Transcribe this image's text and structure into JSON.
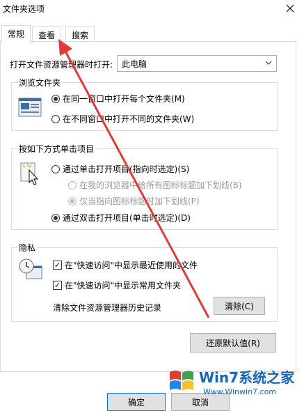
{
  "window": {
    "title": "文件夹选项"
  },
  "tabs": [
    {
      "label": "常规"
    },
    {
      "label": "查看"
    },
    {
      "label": "搜索"
    }
  ],
  "general": {
    "open_explorer_label": "打开文件资源管理器时打开:",
    "open_explorer_value": "此电脑"
  },
  "browse_folders": {
    "title": "浏览文件夹",
    "option_same_window": "在同一窗口中打开每个文件夹(M)",
    "option_new_window": "在不同窗口中打开不同的文件夹(W)"
  },
  "click_items": {
    "title": "按如下方式单击项目",
    "option_single_click": "通过单击打开项目(指向时选定)(S)",
    "sub_underline_all": "在我的浏览器中给所有图标标题加下划线(B)",
    "sub_underline_point": "仅当指向图标标题时加下划线(P)",
    "option_double_click": "通过双击打开项目(单击时选定)(D)"
  },
  "privacy": {
    "title": "隐私",
    "show_recent_files": "在\"快速访问\"中显示最近使用的文件",
    "show_frequent_folders": "在\"快速访问\"中显示常用文件夹",
    "clear_history_label": "清除文件资源管理器历史记录",
    "clear_button": "清除(C)"
  },
  "restore_defaults_button": "还原默认值(R)",
  "footer": {
    "ok_button": "确定",
    "cancel_button": "取消"
  },
  "watermark": {
    "brand": "Win7系统之家",
    "url": "Www.Winwin7.com"
  },
  "colors": {
    "arrow": "#e53935",
    "accent": "#0078d7",
    "disabled": "#9a9a9a"
  }
}
